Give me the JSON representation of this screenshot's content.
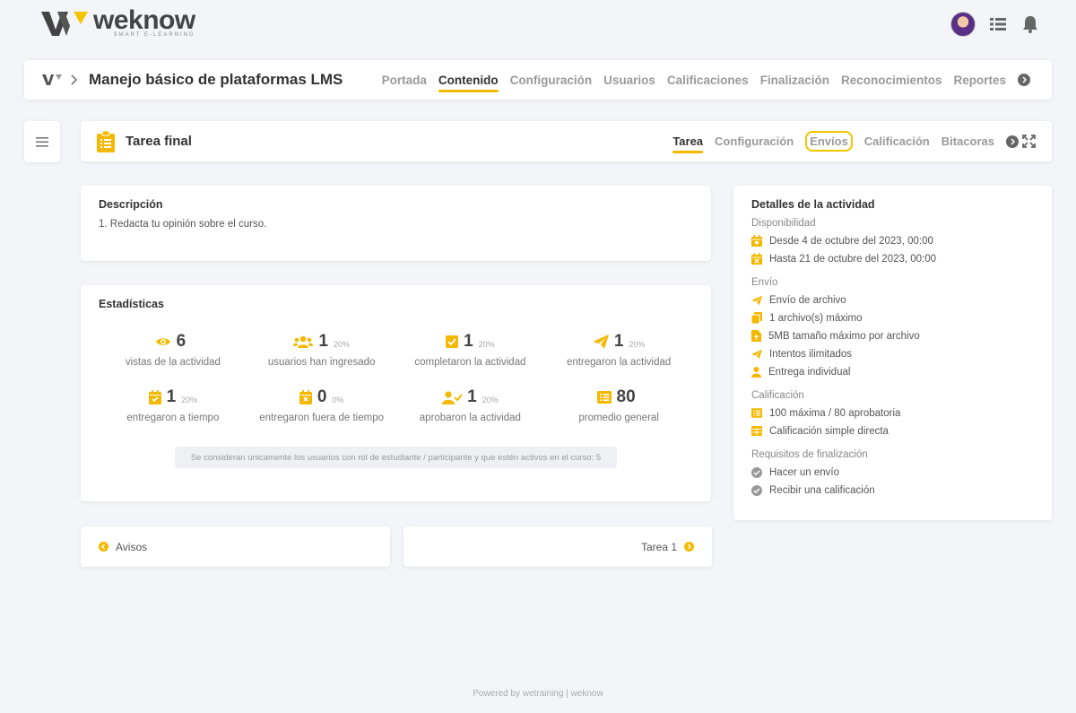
{
  "brand": {
    "name": "weknow",
    "tagline": "SMART E-LEARNING"
  },
  "course": {
    "title": "Manejo básico de plataformas LMS",
    "nav": [
      "Portada",
      "Contenido",
      "Configuración",
      "Usuarios",
      "Calificaciones",
      "Finalización",
      "Reconocimientos",
      "Reportes"
    ],
    "active": "Contenido"
  },
  "task": {
    "title": "Tarea final",
    "nav": [
      "Tarea",
      "Configuración",
      "Envíos",
      "Calificación",
      "Bitacoras"
    ],
    "active": "Tarea",
    "highlighted": "Envíos"
  },
  "description": {
    "heading": "Descripción",
    "text": "1. Redacta tu opinión sobre el curso."
  },
  "stats": {
    "heading": "Estadísticas",
    "items": [
      {
        "value": "6",
        "pct": "",
        "label": "vistas de la actividad",
        "icon": "eye-icon"
      },
      {
        "value": "1",
        "pct": "20%",
        "label": "usuarios han ingresado",
        "icon": "users-icon"
      },
      {
        "value": "1",
        "pct": "20%",
        "label": "completaron la actividad",
        "icon": "check-square-icon"
      },
      {
        "value": "1",
        "pct": "20%",
        "label": "entregaron la actividad",
        "icon": "paper-plane-icon"
      },
      {
        "value": "1",
        "pct": "20%",
        "label": "entregaron a tiempo",
        "icon": "calendar-check-icon"
      },
      {
        "value": "0",
        "pct": "0%",
        "label": "entregaron fuera de tiempo",
        "icon": "calendar-x-icon"
      },
      {
        "value": "1",
        "pct": "20%",
        "label": "aprobaron la actividad",
        "icon": "user-check-icon"
      },
      {
        "value": "80",
        "pct": "",
        "label": "promedio general",
        "icon": "list-icon"
      }
    ],
    "note": "Se consideran únicamente los usuarios con rol de estudiante / participante y que estén activos en el curso: 5"
  },
  "pager": {
    "prev": "Avisos",
    "next": "Tarea 1"
  },
  "details": {
    "heading": "Detalles de la actividad",
    "availability": {
      "title": "Disponibilidad",
      "from": "Desde 4 de octubre del 2023, 00:00",
      "to": "Hasta 21 de octubre del 2023, 00:00"
    },
    "submission": {
      "title": "Envío",
      "items": [
        "Envío de archivo",
        "1 archivo(s) máximo",
        "5MB tamaño máximo por archivo",
        "Intentos ilimitados",
        "Entrega individual"
      ]
    },
    "grading": {
      "title": "Calificación",
      "items": [
        "100 máxima / 80 aprobatoria",
        "Calificación simple directa"
      ]
    },
    "completion": {
      "title": "Requisitos de finalización",
      "items": [
        "Hacer un envío",
        "Recibir una calificación"
      ]
    }
  },
  "footer": "Powered by wetraining | weknow",
  "colors": {
    "accent": "#f5b800",
    "text": "#333333",
    "muted": "#9a9a9a",
    "background": "#f4f5f8"
  }
}
